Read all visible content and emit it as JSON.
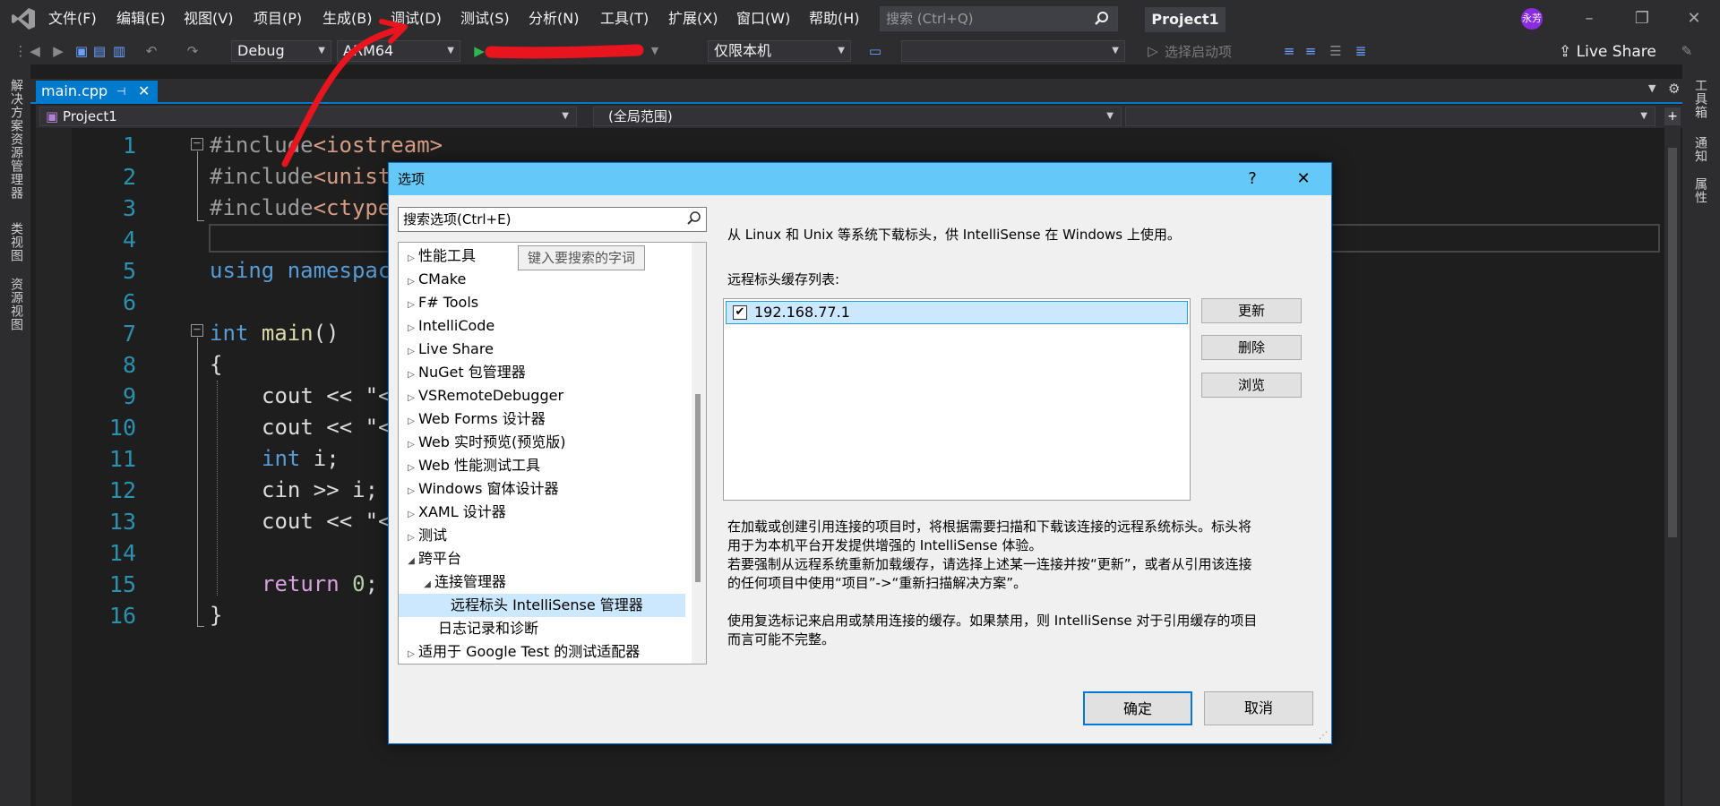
{
  "menubar": {
    "items": [
      "文件(F)",
      "编辑(E)",
      "视图(V)",
      "项目(P)",
      "生成(B)",
      "调试(D)",
      "测试(S)",
      "分析(N)",
      "工具(T)",
      "扩展(X)",
      "窗口(W)",
      "帮助(H)"
    ],
    "search_placeholder": "搜索 (Ctrl+Q)",
    "project_name": "Project1",
    "avatar_text": "永芳"
  },
  "toolbar": {
    "config": "Debug",
    "platform": "ARM64",
    "target": "仅限本机",
    "startup": "选择启动项",
    "live_share": "Live Share"
  },
  "left_strip": [
    "解决方案资源管理器",
    "类视图",
    "资源视图"
  ],
  "right_strip": [
    "工具箱",
    "通知",
    "属性"
  ],
  "editor": {
    "tab_label": "main.cpp",
    "nav_project": "Project1",
    "nav_scope": "(全局范围)",
    "line_numbers": [
      "1",
      "2",
      "3",
      "4",
      "5",
      "6",
      "7",
      "8",
      "9",
      "10",
      "11",
      "12",
      "13",
      "14",
      "15",
      "16"
    ],
    "lines": {
      "l1_pp": "#include",
      "l1_inc": "<iostream>",
      "l2_pp": "#include",
      "l2_inc": "<unist",
      "l3_pp": "#include",
      "l3_inc": "<ctype",
      "l5_kw": "using namespac",
      "l7_kw": "int",
      "l7_fn": "main",
      "l7_rest": "()",
      "l8": "{",
      "l9": "cout << \"<",
      "l10": "cout << \"<",
      "l11_kw": "int",
      "l11_rest": " i;",
      "l12": "cin >> i;",
      "l13": "cout << \"<",
      "l15_ctrl": "return",
      "l15_num": "0",
      "l15_rest": ";",
      "l16": "}"
    }
  },
  "dialog": {
    "title": "选项",
    "help": "?",
    "close": "✕",
    "search_placeholder": "搜索选项(Ctrl+E)",
    "tooltip": "键入要搜索的字词",
    "tree": [
      {
        "label": "性能工具",
        "arrow": "▷"
      },
      {
        "label": "CMake",
        "arrow": "▷"
      },
      {
        "label": "F# Tools",
        "arrow": "▷"
      },
      {
        "label": "IntelliCode",
        "arrow": "▷"
      },
      {
        "label": "Live Share",
        "arrow": "▷"
      },
      {
        "label": "NuGet 包管理器",
        "arrow": "▷"
      },
      {
        "label": "VSRemoteDebugger",
        "arrow": "▷"
      },
      {
        "label": "Web Forms 设计器",
        "arrow": "▷"
      },
      {
        "label": "Web 实时预览(预览版)",
        "arrow": "▷"
      },
      {
        "label": "Web 性能测试工具",
        "arrow": "▷"
      },
      {
        "label": "Windows 窗体设计器",
        "arrow": "▷"
      },
      {
        "label": "XAML 设计器",
        "arrow": "▷"
      },
      {
        "label": "测试",
        "arrow": "▷"
      },
      {
        "label": "跨平台",
        "arrow": "◢"
      },
      {
        "label": "连接管理器",
        "arrow": "◢"
      },
      {
        "label": "远程标头 IntelliSense 管理器",
        "arrow": ""
      },
      {
        "label": "日志记录和诊断",
        "arrow": ""
      },
      {
        "label": "适用于 Google Test 的测试适配器",
        "arrow": "▷"
      }
    ],
    "intro": "从 Linux 和 Unix 等系统下载标头，供 IntelliSense 在 Windows 上使用。",
    "list_label": "远程标头缓存列表:",
    "list_item": "192.168.77.1",
    "btn_update": "更新",
    "btn_delete": "删除",
    "btn_browse": "浏览",
    "desc1_l1": "在加载或创建引用连接的项目时，将根据需要扫描和下载该连接的远程系统标头。标头将",
    "desc1_l2": "用于为本机平台开发提供增强的 IntelliSense 体验。",
    "desc1_l3": "若要强制从远程系统重新加载缓存，请选择上述某一连接并按“更新”，或者从引用该连接",
    "desc1_l4": "的任何项目中使用“项目”->“重新扫描解决方案”。",
    "desc2_l1": "使用复选标记来启用或禁用连接的缓存。如果禁用，则 IntelliSense 对于引用缓存的项目",
    "desc2_l2": "而言可能不完整。",
    "ok": "确定",
    "cancel": "取消"
  },
  "colors": {
    "accent": "#007acc",
    "dialog_title": "#64c8f8",
    "annotation": "#e8141e"
  }
}
